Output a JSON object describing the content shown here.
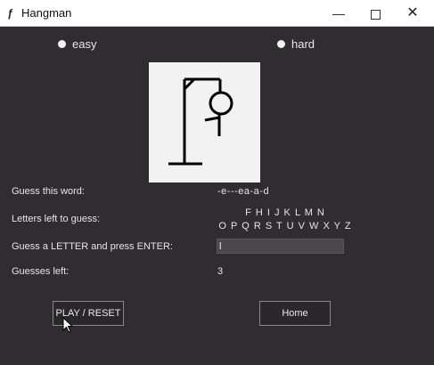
{
  "window": {
    "title": "Hangman",
    "icon": "feather-icon",
    "controls": {
      "minimize": "—",
      "close": "✕"
    }
  },
  "difficulty": {
    "easy_label": "easy",
    "hard_label": "hard"
  },
  "game": {
    "guess_word_label": "Guess this word:",
    "word_display": "-e---ea-a-d",
    "letters_left_label": "Letters left to guess:",
    "letters_line1": "F H I J K L M N",
    "letters_line2": "O P Q R S T U V W X Y Z",
    "guess_letter_label": "Guess a LETTER and press ENTER:",
    "guess_input_value": "l",
    "guesses_left_label": "Guesses left:",
    "guesses_left_value": "3"
  },
  "buttons": {
    "play_reset": "PLAY / RESET",
    "home": "Home"
  },
  "colors": {
    "background": "#302d30",
    "canvas": "#f2f2f2",
    "text": "#e6e6e6"
  }
}
